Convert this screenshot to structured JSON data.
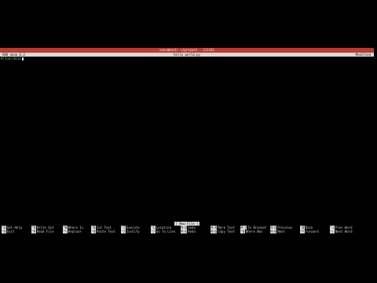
{
  "window": {
    "title": "user@host: ~/project - 117x51"
  },
  "nano": {
    "version": "GNU nano 6.2",
    "filename": "hello_world.py",
    "state": "Modified",
    "first_line": "#!/usr/bin/"
  },
  "status_message": "[ New File ]",
  "shortcuts": {
    "row1": [
      {
        "key": "^G",
        "label": "Get Help"
      },
      {
        "key": "^O",
        "label": "Write Out"
      },
      {
        "key": "^W",
        "label": "Where Is"
      },
      {
        "key": "^K",
        "label": "Cut Text"
      },
      {
        "key": "^T",
        "label": "Execute"
      },
      {
        "key": "^C",
        "label": "Location"
      },
      {
        "key": "M-U",
        "label": "Undo"
      },
      {
        "key": "M-A",
        "label": "Mark Text"
      },
      {
        "key": "M-]",
        "label": "To Bracket"
      },
      {
        "key": "M-Q",
        "label": "Previous"
      },
      {
        "key": "^B",
        "label": "Back"
      },
      {
        "key": "^◂",
        "label": "Prev Word"
      }
    ],
    "row2": [
      {
        "key": "^X",
        "label": "Exit"
      },
      {
        "key": "^R",
        "label": "Read File"
      },
      {
        "key": "^\\",
        "label": "Replace"
      },
      {
        "key": "^U",
        "label": "Paste Text"
      },
      {
        "key": "^J",
        "label": "Justify"
      },
      {
        "key": "^/",
        "label": "Go To Line"
      },
      {
        "key": "M-E",
        "label": "Redo"
      },
      {
        "key": "M-6",
        "label": "Copy Text"
      },
      {
        "key": "^Q",
        "label": "Where Was"
      },
      {
        "key": "M-W",
        "label": "Next"
      },
      {
        "key": "^F",
        "label": "Forward"
      },
      {
        "key": "^▸",
        "label": "Next Word"
      }
    ]
  },
  "colors": {
    "title_bar": "#c0392b",
    "header_bg": "#d9d9d9",
    "background": "#000000"
  }
}
